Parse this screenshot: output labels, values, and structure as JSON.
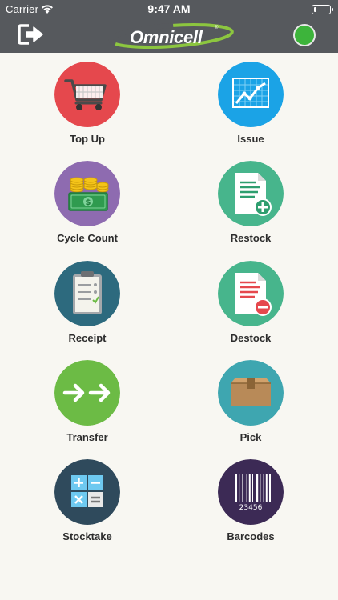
{
  "status_bar": {
    "carrier": "Carrier",
    "time": "9:47 AM"
  },
  "nav_bar": {
    "logo_text": "Omnicell",
    "logo_reg": "®",
    "connection_status_color": "#3db43b"
  },
  "tiles": [
    {
      "label": "Top Up",
      "icon": "shopping-cart-icon",
      "color": "#e5484d"
    },
    {
      "label": "Issue",
      "icon": "line-chart-icon",
      "color": "#1ba3e6"
    },
    {
      "label": "Cycle Count",
      "icon": "coins-cash-icon",
      "color": "#8e6bb0"
    },
    {
      "label": "Restock",
      "icon": "document-add-icon",
      "color": "#47b58c"
    },
    {
      "label": "Receipt",
      "icon": "clipboard-check-icon",
      "color": "#2d6a7e"
    },
    {
      "label": "Destock",
      "icon": "document-remove-icon",
      "color": "#47b58c"
    },
    {
      "label": "Transfer",
      "icon": "double-arrow-icon",
      "color": "#6cbb45"
    },
    {
      "label": "Pick",
      "icon": "box-icon",
      "color": "#3ea6b0"
    },
    {
      "label": "Stocktake",
      "icon": "calculator-icon",
      "color": "#2f4a5c"
    },
    {
      "label": "Barcodes",
      "icon": "barcode-icon",
      "color": "#3c2a55"
    }
  ],
  "barcode_number": "23456"
}
